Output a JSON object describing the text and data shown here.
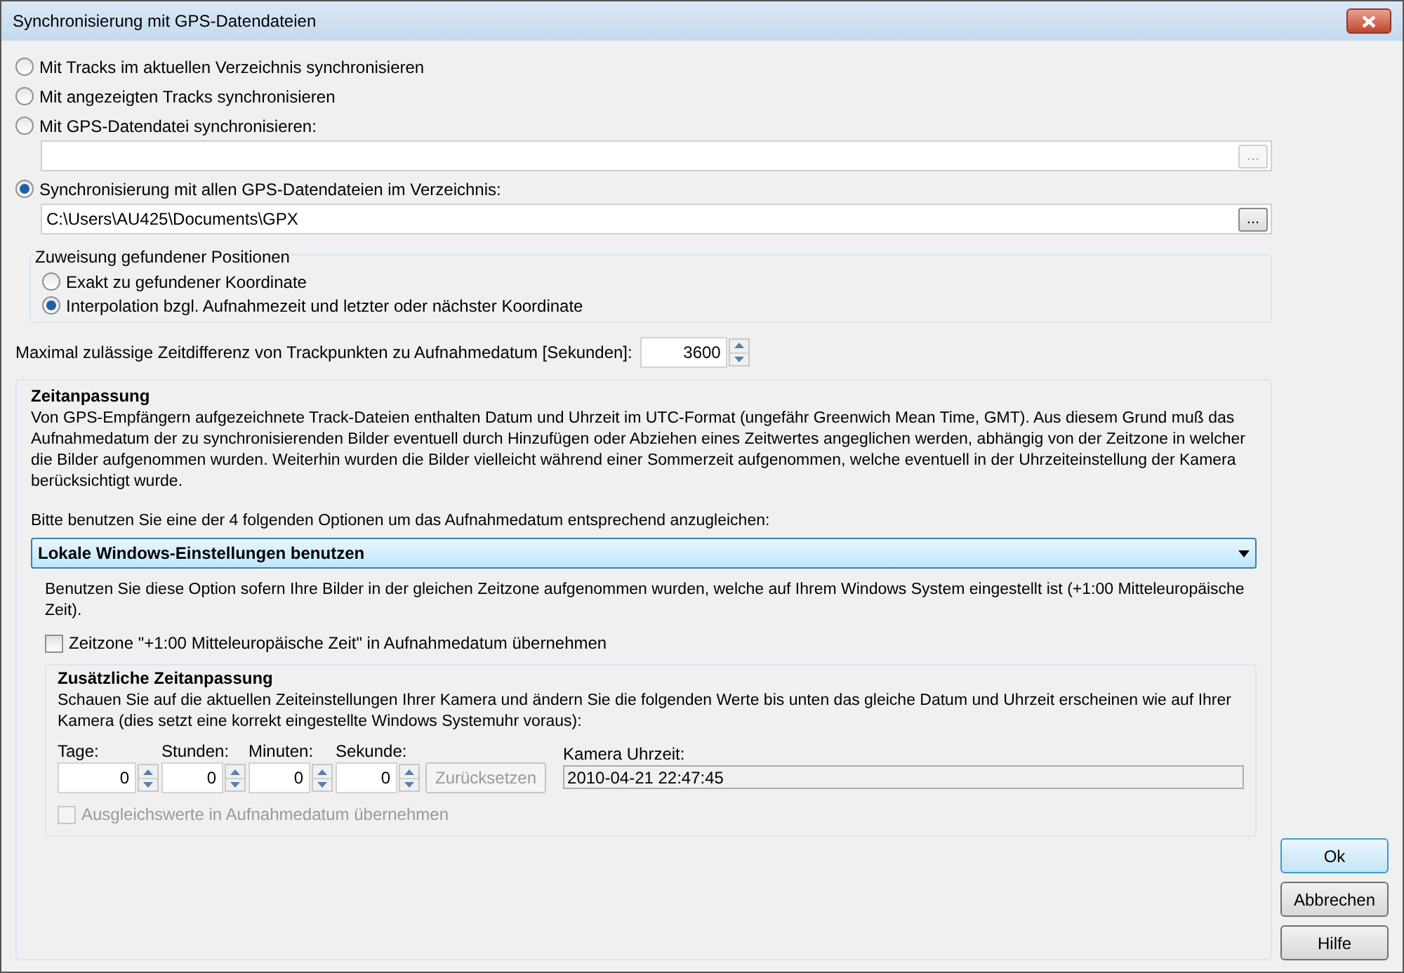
{
  "window": {
    "title": "Synchronisierung mit GPS-Datendateien"
  },
  "source_options": [
    {
      "kind": "plain",
      "label": "Mit Tracks im aktuellen Verzeichnis synchronisieren",
      "selected": false
    },
    {
      "kind": "plain",
      "label": "Mit angezeigten Tracks synchronisieren",
      "selected": false
    },
    {
      "kind": "file",
      "label": "Mit GPS-Datendatei synchronisieren:",
      "selected": false,
      "browse": "...",
      "browse_disabled": true
    },
    {
      "kind": "file",
      "label": "Synchronisierung mit allen GPS-Datendateien im Verzeichnis:",
      "selected": true,
      "value": "C:\\Users\\AU425\\Documents\\GPX",
      "browse": "...",
      "browse_disabled": false
    }
  ],
  "assignment": {
    "title": "Zuweisung gefundener Positionen",
    "options": [
      {
        "label": "Exakt zu gefundener Koordinate",
        "selected": false
      },
      {
        "label": "Interpolation bzgl. Aufnahmezeit und letzter oder nächster Koordinate",
        "selected": true
      }
    ]
  },
  "max_diff": {
    "label": "Maximal zulässige Zeitdifferenz von Trackpunkten zu Aufnahmedatum [Sekunden]:",
    "value": "3600"
  },
  "time_adjust": {
    "title": "Zeitanpassung",
    "description": "Von GPS-Empfängern aufgezeichnete Track-Dateien enthalten Datum und Uhrzeit im UTC-Format (ungefähr Greenwich Mean Time, GMT). Aus diesem Grund muß das Aufnahmedatum der zu synchronisierenden Bilder eventuell durch Hinzufügen oder Abziehen eines Zeitwertes angeglichen werden, abhängig von der Zeitzone in welcher die Bilder aufgenommen wurden. Weiterhin wurden die Bilder vielleicht während einer Sommerzeit aufgenommen, welche eventuell in der Uhrzeiteinstellung der Kamera berücksichtigt wurde.",
    "prompt": "Bitte benutzen Sie eine der 4 folgenden Optionen um das Aufnahmedatum entsprechend anzugleichen:",
    "dropdown": {
      "value": "Lokale Windows-Einstellungen benutzen"
    },
    "option_hint": "Benutzen Sie diese Option sofern Ihre Bilder in der gleichen Zeitzone aufgenommen wurden, welche auf Ihrem Windows System eingestellt ist (+1:00 Mitteleuropäische Zeit).",
    "timezone_checkbox": {
      "label": "Zeitzone \"+1:00 Mitteleuropäische Zeit\" in Aufnahmedatum übernehmen",
      "checked": false
    },
    "extra": {
      "title": "Zusätzliche Zeitanpassung",
      "description": "Schauen Sie auf die aktuellen Zeiteinstellungen Ihrer Kamera und ändern Sie die folgenden Werte bis unten das gleiche Datum und Uhrzeit erscheinen wie auf Ihrer Kamera (dies setzt eine korrekt eingestellte Windows Systemuhr voraus):",
      "spinners": [
        {
          "label": "Tage:",
          "value": "0"
        },
        {
          "label": "Stunden:",
          "value": "0"
        },
        {
          "label": "Minuten:",
          "value": "0"
        },
        {
          "label": "Sekunde:",
          "value": "0"
        }
      ],
      "reset_button": {
        "label": "Zurücksetzen",
        "disabled": true
      },
      "camera_time": {
        "label": "Kamera Uhrzeit:",
        "value": "2010-04-21 22:47:45"
      },
      "apply_checkbox": {
        "label": "Ausgleichswerte in Aufnahmedatum übernehmen",
        "checked": false,
        "disabled": true
      }
    }
  },
  "buttons": [
    {
      "label": "Ok",
      "default": true
    },
    {
      "label": "Abbrechen",
      "default": false
    },
    {
      "label": "Hilfe",
      "default": false
    }
  ]
}
